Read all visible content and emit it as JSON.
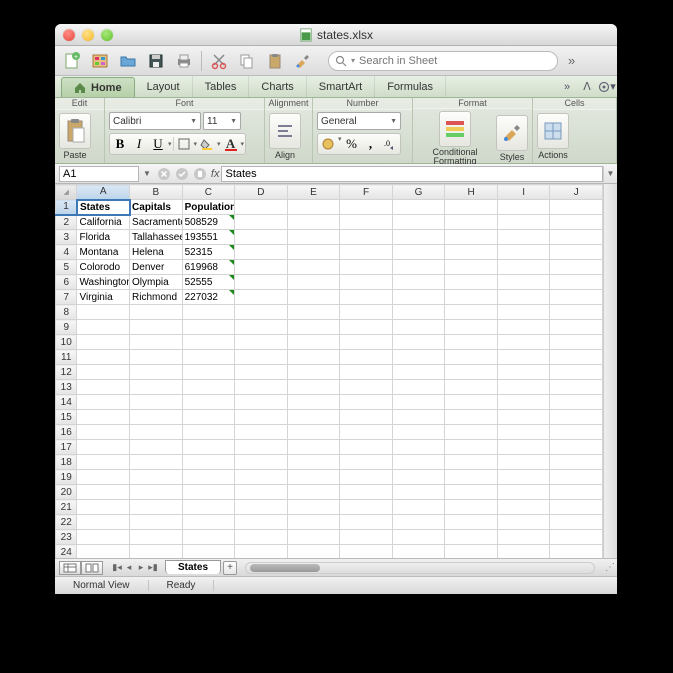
{
  "title": "states.xlsx",
  "search_placeholder": "Search in Sheet",
  "tabs": {
    "home": "Home",
    "layout": "Layout",
    "tables": "Tables",
    "charts": "Charts",
    "smartart": "SmartArt",
    "formulas": "Formulas"
  },
  "ribbon": {
    "edit": "Edit",
    "paste": "Paste",
    "font": "Font",
    "font_name": "Calibri",
    "font_size": "11",
    "alignment": "Alignment",
    "align": "Align",
    "number": "Number",
    "number_format": "General",
    "format": "Format",
    "conditional": "Conditional Formatting",
    "styles": "Styles",
    "cells": "Cells",
    "actions": "Actions"
  },
  "formula": {
    "cell_ref": "A1",
    "content": "States"
  },
  "columns": [
    "A",
    "B",
    "C",
    "D",
    "E",
    "F",
    "G",
    "H",
    "I",
    "J"
  ],
  "rows_visible": 25,
  "active_cell": {
    "row": 1,
    "col": 0
  },
  "sheet_data": {
    "headers": [
      "States",
      "Capitals",
      "Population"
    ],
    "rows": [
      [
        "California",
        "Sacramento",
        "508529"
      ],
      [
        "Florida",
        "Tallahassee",
        "193551"
      ],
      [
        "Montana",
        "Helena",
        "52315"
      ],
      [
        "Colorodo",
        "Denver",
        "619968"
      ],
      [
        "Washington",
        "Olympia",
        "52555"
      ],
      [
        "Virginia",
        "Richmond",
        "227032"
      ]
    ]
  },
  "sheet_name": "States",
  "status": {
    "view": "Normal View",
    "ready": "Ready"
  }
}
